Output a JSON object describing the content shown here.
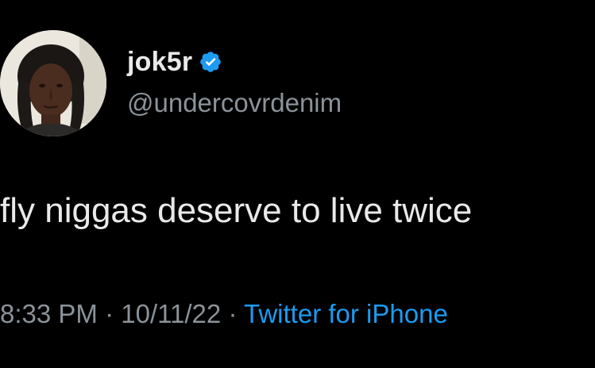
{
  "tweet": {
    "display_name": "jok5r",
    "handle": "@undercovrdenim",
    "text": "fly niggas deserve to live twice",
    "time": "8:33 PM",
    "separator": "·",
    "date": "10/11/22",
    "source": "Twitter for iPhone"
  },
  "colors": {
    "background": "#000000",
    "text_primary": "#e9e9e9",
    "text_secondary": "#8b9299",
    "link": "#1d9bf0",
    "verified_badge": "#1d9bf0"
  },
  "icons": {
    "verified": "verified-badge-icon",
    "avatar": "profile-photo"
  }
}
